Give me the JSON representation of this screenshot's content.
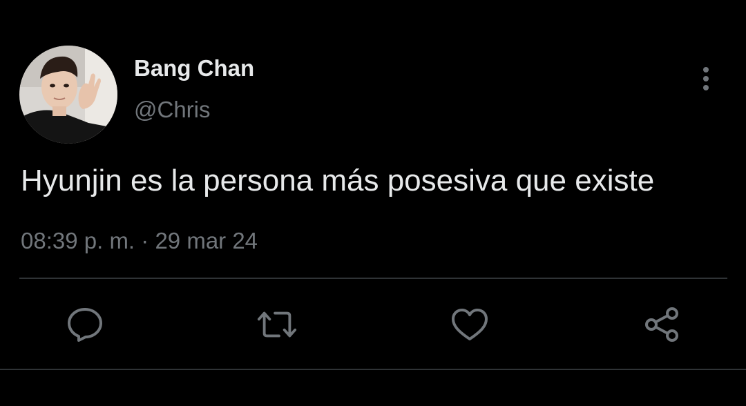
{
  "author": {
    "display_name": "Bang Chan",
    "handle": "@Chris",
    "avatar_icon": "profile-photo"
  },
  "tweet": {
    "text": "Hyunjin es la persona más posesiva que existe",
    "time": "08:39 p. m.",
    "separator": "·",
    "date": "29 mar 24"
  },
  "actions": {
    "reply_icon": "reply-icon",
    "retweet_icon": "retweet-icon",
    "like_icon": "heart-icon",
    "share_icon": "share-icon",
    "more_icon": "more-vertical-icon"
  },
  "colors": {
    "background": "#000000",
    "text_primary": "#e7e9ea",
    "text_secondary": "#71767b",
    "divider": "#2f3336",
    "icon": "#71767b"
  }
}
